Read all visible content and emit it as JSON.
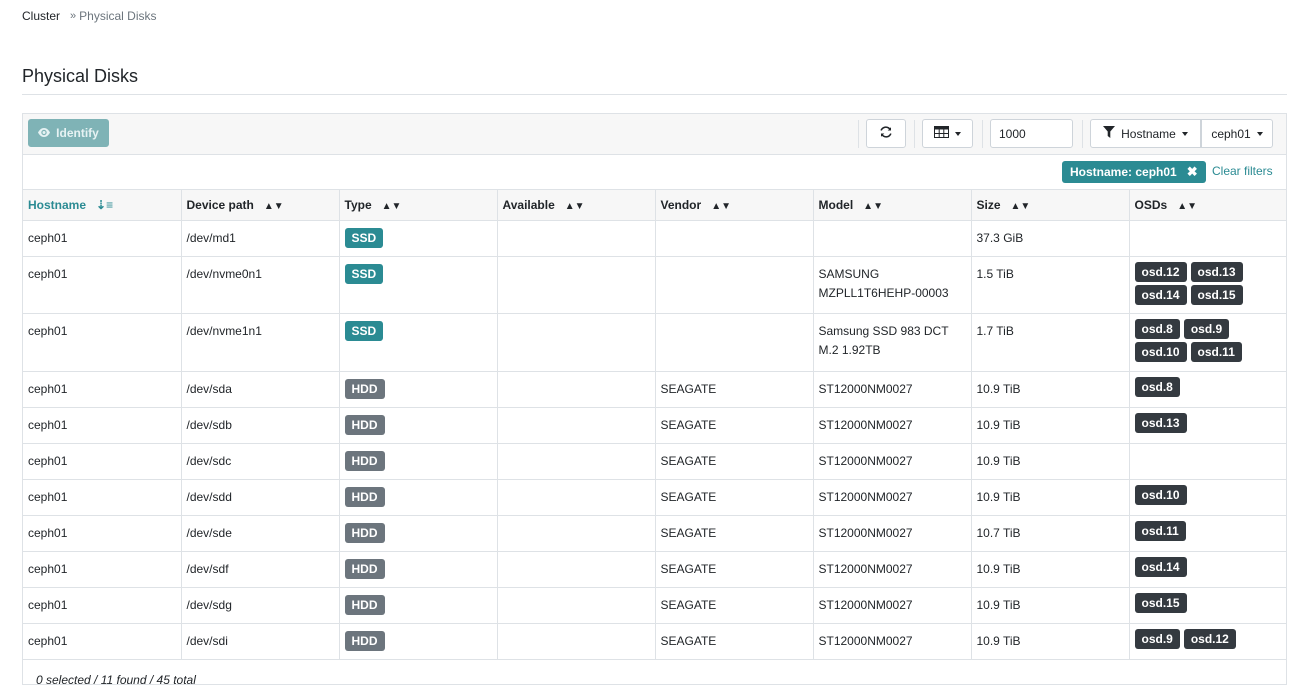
{
  "breadcrumb": {
    "root": "Cluster",
    "separator": "»",
    "current": "Physical Disks"
  },
  "page": {
    "title": "Physical Disks"
  },
  "toolbar": {
    "identify_label": "Identify",
    "identify_icon": "eye-icon",
    "refresh_icon": "refresh-icon",
    "columns_icon": "table-columns-icon",
    "limit_value": "1000",
    "filter_field_label": "Hostname",
    "filter_value_label": "ceph01"
  },
  "active_filter": {
    "label": "Hostname: ceph01",
    "clear_label": "Clear filters"
  },
  "table": {
    "columns": [
      "Hostname",
      "Device path",
      "Type",
      "Available",
      "Vendor",
      "Model",
      "Size",
      "OSDs"
    ],
    "sorted_column": "Hostname",
    "rows": [
      {
        "hostname": "ceph01",
        "device_path": "/dev/md1",
        "type": "SSD",
        "available": "",
        "vendor": "",
        "model": "",
        "size": "37.3 GiB",
        "osds": []
      },
      {
        "hostname": "ceph01",
        "device_path": "/dev/nvme0n1",
        "type": "SSD",
        "available": "",
        "vendor": "",
        "model": "SAMSUNG MZPLL1T6HEHP-00003",
        "size": "1.5 TiB",
        "osds": [
          "osd.12",
          "osd.13",
          "osd.14",
          "osd.15"
        ]
      },
      {
        "hostname": "ceph01",
        "device_path": "/dev/nvme1n1",
        "type": "SSD",
        "available": "",
        "vendor": "",
        "model": "Samsung SSD 983 DCT M.2 1.92TB",
        "size": "1.7 TiB",
        "osds": [
          "osd.8",
          "osd.9",
          "osd.10",
          "osd.11"
        ]
      },
      {
        "hostname": "ceph01",
        "device_path": "/dev/sda",
        "type": "HDD",
        "available": "",
        "vendor": "SEAGATE",
        "model": "ST12000NM0027",
        "size": "10.9 TiB",
        "osds": [
          "osd.8"
        ]
      },
      {
        "hostname": "ceph01",
        "device_path": "/dev/sdb",
        "type": "HDD",
        "available": "",
        "vendor": "SEAGATE",
        "model": "ST12000NM0027",
        "size": "10.9 TiB",
        "osds": [
          "osd.13"
        ]
      },
      {
        "hostname": "ceph01",
        "device_path": "/dev/sdc",
        "type": "HDD",
        "available": "",
        "vendor": "SEAGATE",
        "model": "ST12000NM0027",
        "size": "10.9 TiB",
        "osds": []
      },
      {
        "hostname": "ceph01",
        "device_path": "/dev/sdd",
        "type": "HDD",
        "available": "",
        "vendor": "SEAGATE",
        "model": "ST12000NM0027",
        "size": "10.9 TiB",
        "osds": [
          "osd.10"
        ]
      },
      {
        "hostname": "ceph01",
        "device_path": "/dev/sde",
        "type": "HDD",
        "available": "",
        "vendor": "SEAGATE",
        "model": "ST12000NM0027",
        "size": "10.7 TiB",
        "osds": [
          "osd.11"
        ]
      },
      {
        "hostname": "ceph01",
        "device_path": "/dev/sdf",
        "type": "HDD",
        "available": "",
        "vendor": "SEAGATE",
        "model": "ST12000NM0027",
        "size": "10.9 TiB",
        "osds": [
          "osd.14"
        ]
      },
      {
        "hostname": "ceph01",
        "device_path": "/dev/sdg",
        "type": "HDD",
        "available": "",
        "vendor": "SEAGATE",
        "model": "ST12000NM0027",
        "size": "10.9 TiB",
        "osds": [
          "osd.15"
        ]
      },
      {
        "hostname": "ceph01",
        "device_path": "/dev/sdi",
        "type": "HDD",
        "available": "",
        "vendor": "SEAGATE",
        "model": "ST12000NM0027",
        "size": "10.9 TiB",
        "osds": [
          "osd.9",
          "osd.12"
        ]
      }
    ]
  },
  "footer": {
    "count_text": "0 selected / 11 found / 45 total"
  },
  "colors": {
    "accent": "#2b8b93",
    "hdd_badge": "#6c757d",
    "osd_badge": "#343a40",
    "identify_disabled": "#7fb3b6"
  }
}
